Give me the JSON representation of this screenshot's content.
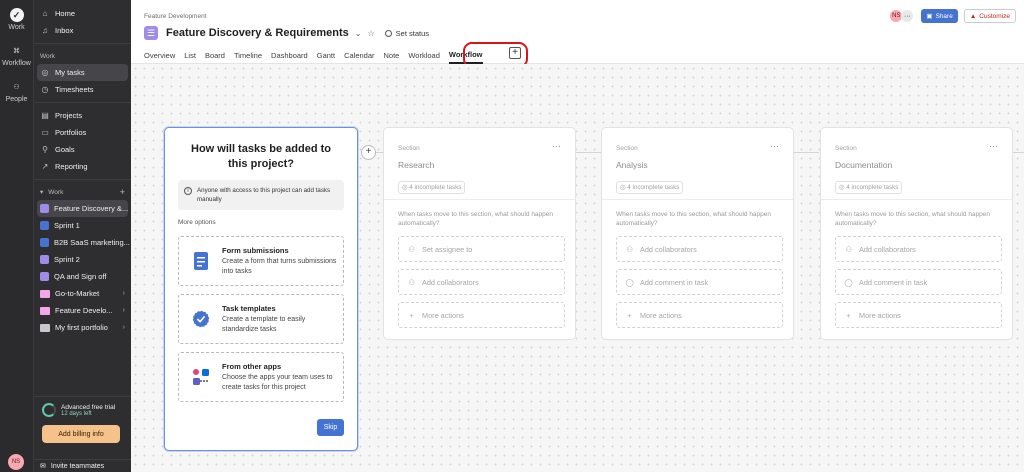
{
  "rail": {
    "items": [
      {
        "label": "Work",
        "icon": "check-circle-icon"
      },
      {
        "label": "Workflow",
        "icon": "workflow-icon"
      },
      {
        "label": "People",
        "icon": "people-icon"
      }
    ],
    "avatar": "NS"
  },
  "sidebar": {
    "top_items": [
      {
        "label": "Home",
        "icon": "home-icon"
      },
      {
        "label": "Inbox",
        "icon": "bell-icon"
      }
    ],
    "work_section": "Work",
    "work_items": [
      {
        "label": "My tasks",
        "icon": "check-circle-icon"
      },
      {
        "label": "Timesheets",
        "icon": "clock-icon"
      }
    ],
    "nav_items": [
      {
        "label": "Projects",
        "icon": "clipboard-icon"
      },
      {
        "label": "Portfolios",
        "icon": "folder-icon"
      },
      {
        "label": "Goals",
        "icon": "person-target-icon"
      },
      {
        "label": "Reporting",
        "icon": "chart-line-icon"
      }
    ],
    "projects_section": "Work",
    "projects": [
      {
        "label": "Feature Discovery &...",
        "color": "#9f8be8",
        "type": "project"
      },
      {
        "label": "Sprint 1",
        "color": "#4573d2",
        "type": "project"
      },
      {
        "label": "B2B SaaS marketing...",
        "color": "#4573d2",
        "type": "project"
      },
      {
        "label": "Sprint 2",
        "color": "#9f8be8",
        "type": "project"
      },
      {
        "label": "QA and Sign off",
        "color": "#9f8be8",
        "type": "project"
      },
      {
        "label": "Go-to-Market",
        "color": "#f1a7e8",
        "type": "folder"
      },
      {
        "label": "Feature Develo...",
        "color": "#f1a7e8",
        "type": "folder"
      },
      {
        "label": "My first portfolio",
        "color": "#c8c8cc",
        "type": "folder"
      }
    ],
    "trial": {
      "title": "Advanced free trial",
      "sub": "12 days left",
      "button": "Add billing info"
    },
    "invite": "Invite teammates"
  },
  "header": {
    "breadcrumb": "Feature Development",
    "title": "Feature Discovery & Requirements",
    "set_status": "Set status",
    "tabs": [
      "Overview",
      "List",
      "Board",
      "Timeline",
      "Dashboard",
      "Gantt",
      "Calendar",
      "Note",
      "Workload",
      "Workflow"
    ],
    "active_tab": "Workflow",
    "avatar": "NS",
    "share": "Share",
    "customize": "Customize"
  },
  "setup": {
    "title": "How will tasks be added to this project?",
    "info": "Anyone with access to this project can add tasks manually",
    "more_options": "More options",
    "options": [
      {
        "title": "Form submissions",
        "desc": "Create a form that turns submissions into tasks",
        "icon": "form-icon"
      },
      {
        "title": "Task templates",
        "desc": "Create a template to easily standardize tasks",
        "icon": "template-check-icon"
      },
      {
        "title": "From other apps",
        "desc": "Choose the apps your team uses to create tasks for this project",
        "icon": "apps-icon"
      }
    ],
    "skip": "Skip"
  },
  "sections": [
    {
      "label": "Section",
      "name": "Research",
      "count": "4 incomplete tasks",
      "question": "When tasks move to this section, what should happen automatically?",
      "actions": [
        {
          "label": "Set assignee to",
          "icon": "person-icon"
        },
        {
          "label": "Add collaborators",
          "icon": "people-icon"
        },
        {
          "label": "More actions",
          "icon": "plus-icon"
        }
      ]
    },
    {
      "label": "Section",
      "name": "Analysis",
      "count": "4 incomplete tasks",
      "question": "When tasks move to this section, what should happen automatically?",
      "actions": [
        {
          "label": "Add collaborators",
          "icon": "people-icon"
        },
        {
          "label": "Add comment in task",
          "icon": "comment-icon"
        },
        {
          "label": "More actions",
          "icon": "plus-icon"
        }
      ]
    },
    {
      "label": "Section",
      "name": "Documentation",
      "count": "4 incomplete tasks",
      "question": "When tasks move to this section, what should happen automatically?",
      "actions": [
        {
          "label": "Add collaborators",
          "icon": "people-icon"
        },
        {
          "label": "Add comment in task",
          "icon": "comment-icon"
        },
        {
          "label": "More actions",
          "icon": "plus-icon"
        }
      ]
    }
  ],
  "colors": {
    "accent": "#4573d2",
    "highlight": "#d8141e",
    "sidebar_bg": "#2e2e30"
  }
}
